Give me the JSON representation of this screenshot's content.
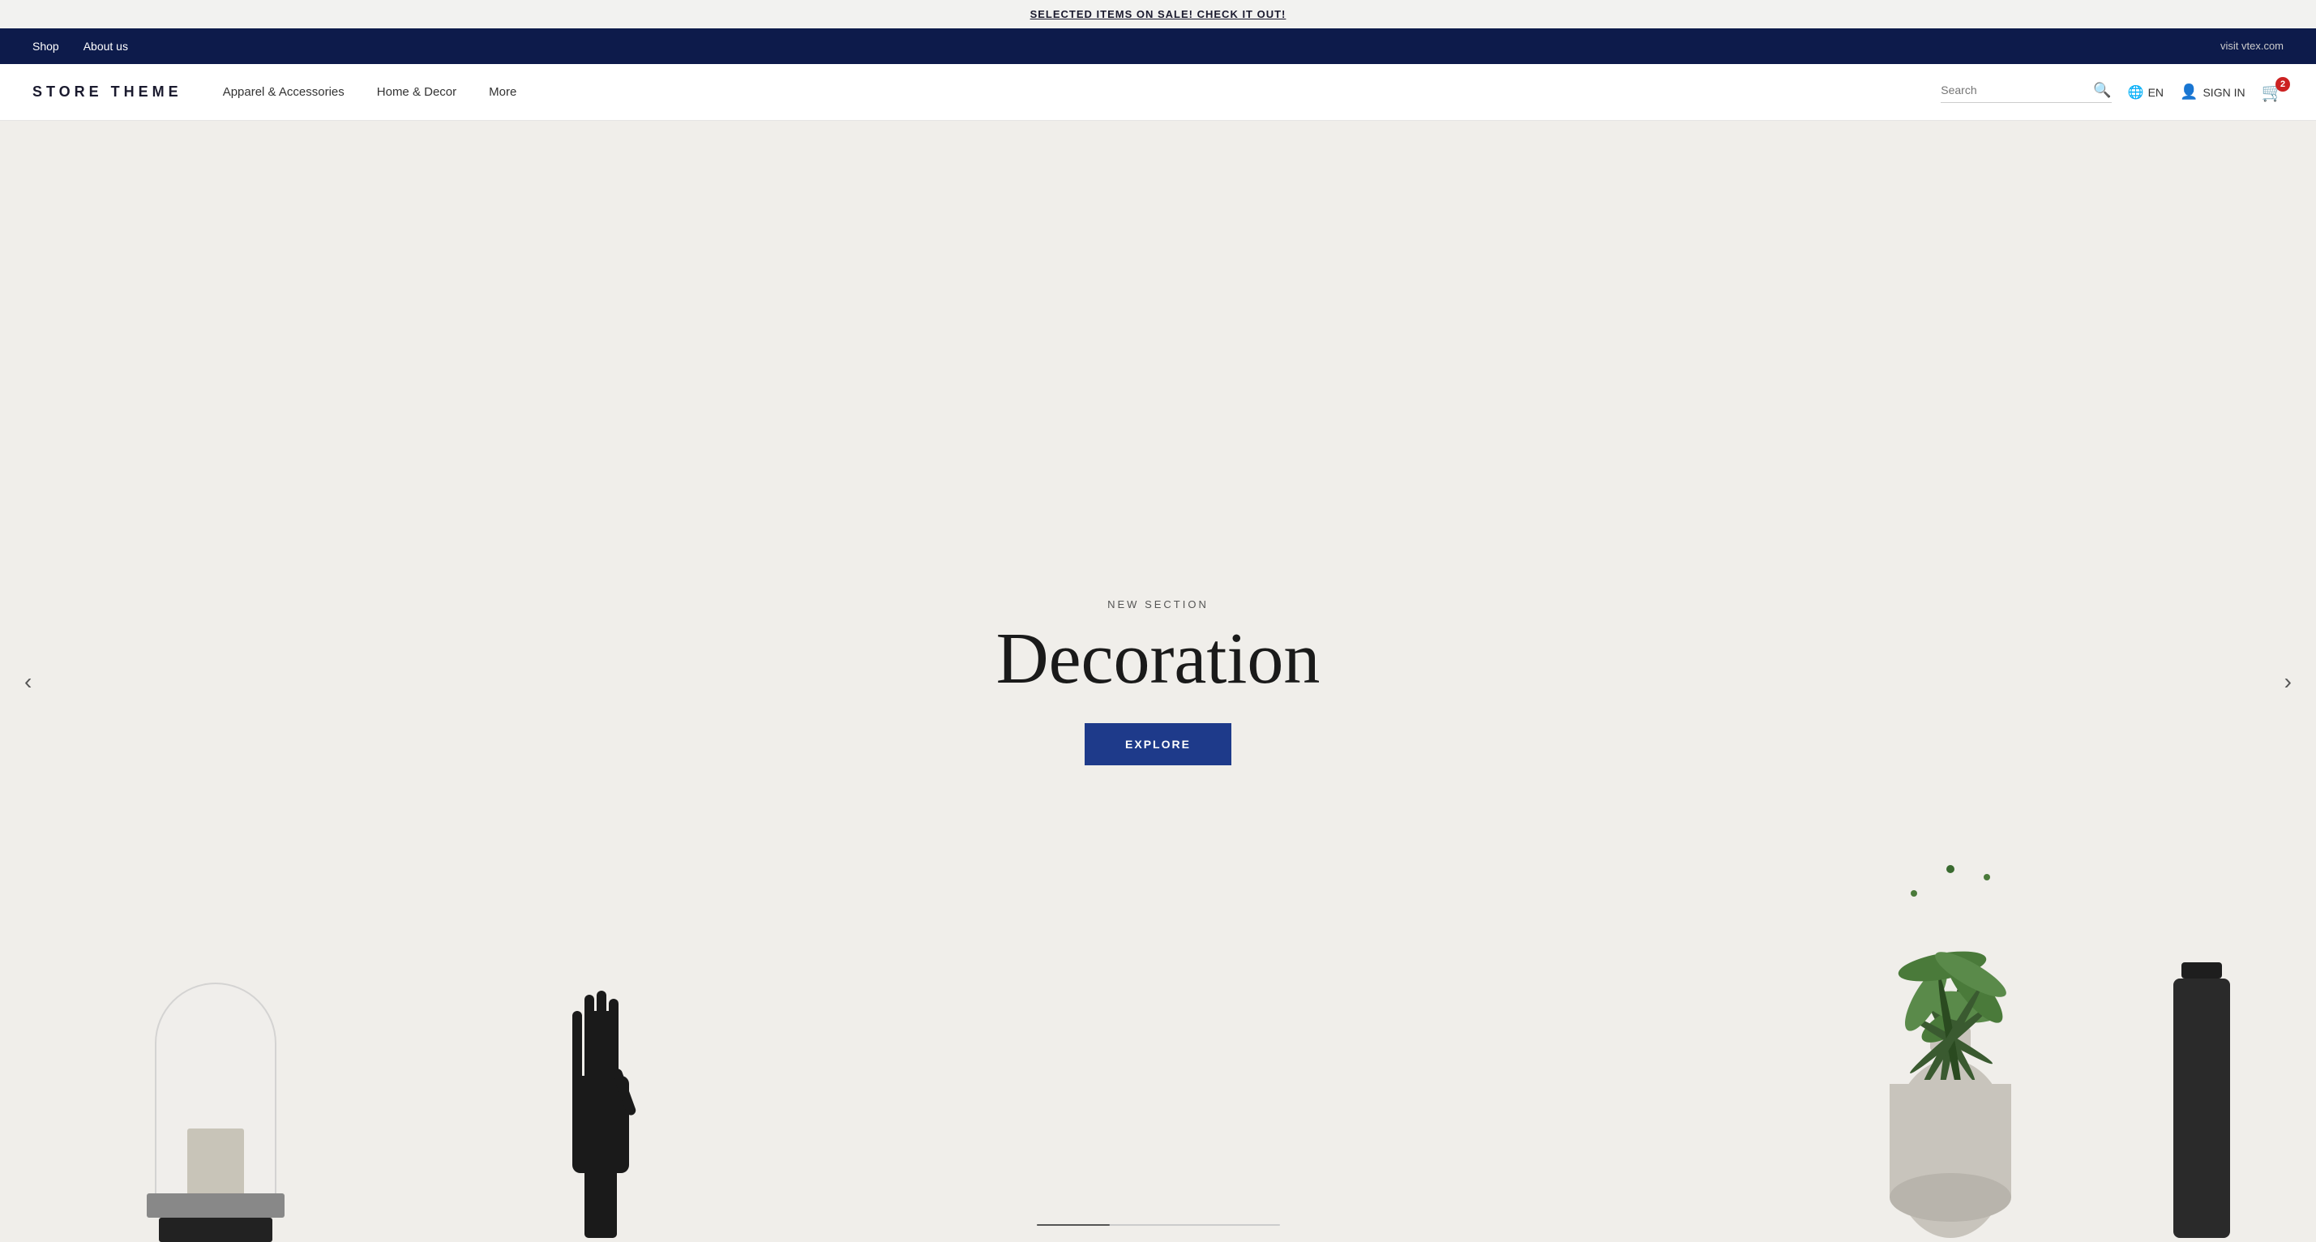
{
  "announcement": {
    "text": "SELECTED ITEMS ON SALE! CHECK IT OUT!"
  },
  "top_nav": {
    "left_links": [
      {
        "label": "Shop",
        "href": "#"
      },
      {
        "label": "About us",
        "href": "#"
      }
    ],
    "right_link": {
      "label": "visit vtex.com",
      "href": "#"
    }
  },
  "header": {
    "logo": "STORE THEME",
    "nav_links": [
      {
        "label": "Apparel & Accessories"
      },
      {
        "label": "Home & Decor"
      },
      {
        "label": "More"
      }
    ],
    "search_placeholder": "Search",
    "lang": "EN",
    "sign_in": "SIGN IN",
    "cart_count": "2"
  },
  "hero": {
    "subtitle": "NEW SECTION",
    "title": "Decoration",
    "cta_label": "EXPLORE"
  },
  "carousel": {
    "prev_label": "‹",
    "next_label": "›"
  }
}
